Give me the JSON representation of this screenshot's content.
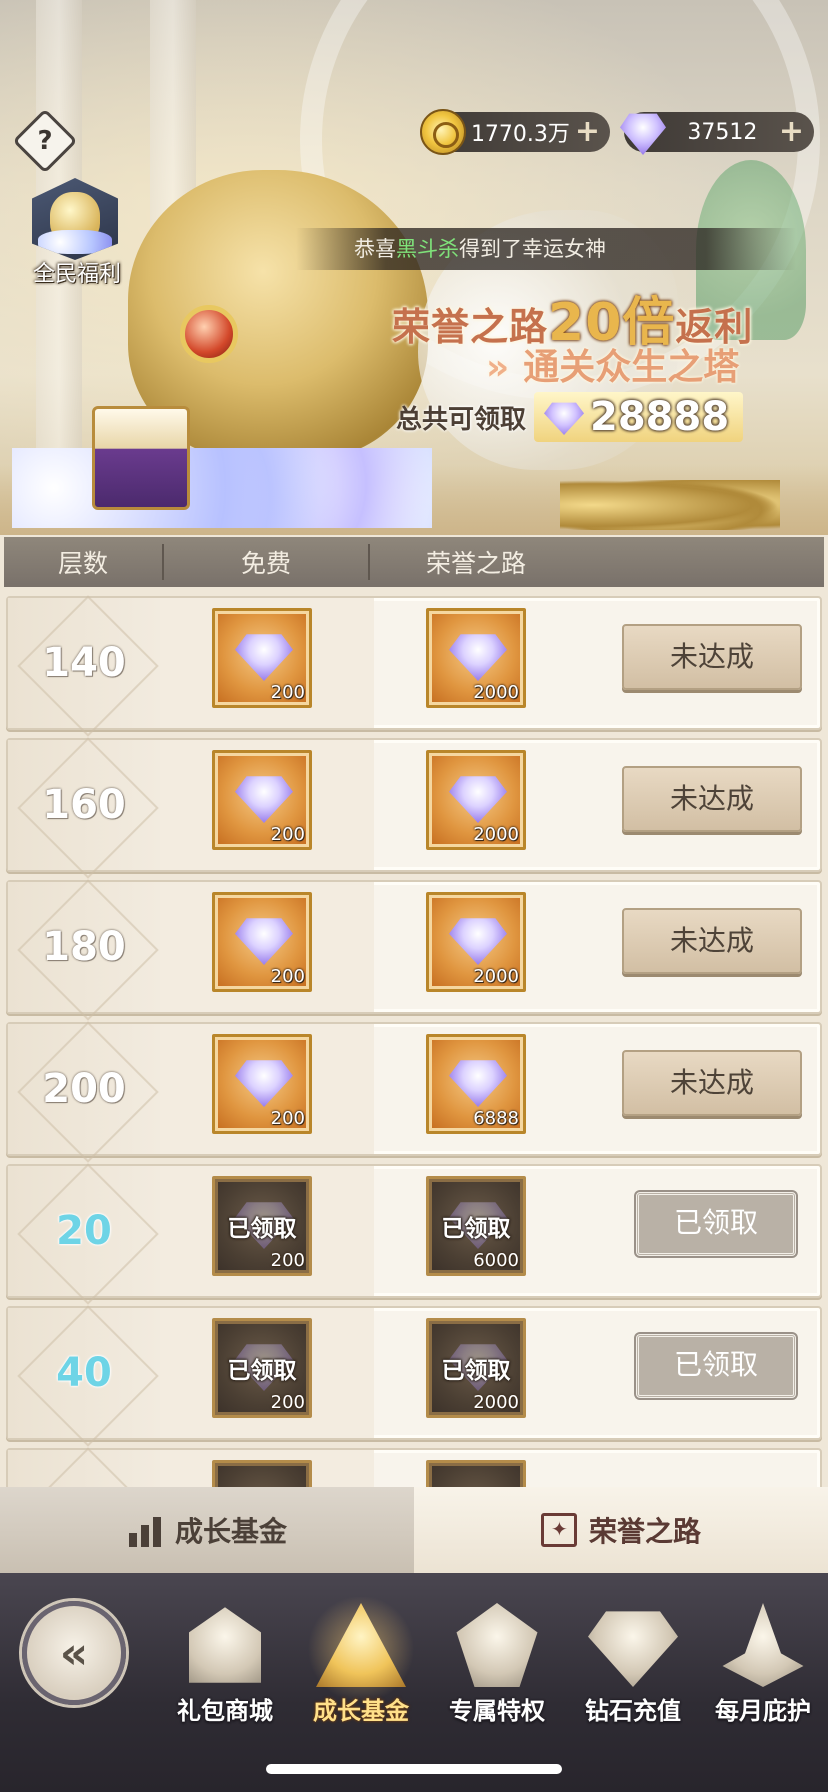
{
  "header": {
    "help_icon_glyph": "?",
    "welfare_label": "全民福利",
    "currencies": {
      "gold": {
        "value": "1770.3万",
        "plus": "+"
      },
      "diamond": {
        "value": "37512",
        "plus": "+"
      }
    },
    "notice": {
      "prefix": "恭喜",
      "player": "黑斗杀",
      "suffix": "得到了幸运女神"
    },
    "promo": {
      "line1_pre": "荣誉之路",
      "line1_big": "20倍",
      "line1_post": "返利",
      "line2_chevron": "»",
      "line2": "通关众生之塔",
      "total_label": "总共可领取",
      "total_amount": "28888"
    }
  },
  "table": {
    "headers": [
      "层数",
      "免费",
      "荣誉之路"
    ],
    "rows": [
      {
        "floor": "140",
        "free_qty": "200",
        "honor_qty": "2000",
        "status": "未达成",
        "claimed": false
      },
      {
        "floor": "160",
        "free_qty": "200",
        "honor_qty": "2000",
        "status": "未达成",
        "claimed": false
      },
      {
        "floor": "180",
        "free_qty": "200",
        "honor_qty": "2000",
        "status": "未达成",
        "claimed": false
      },
      {
        "floor": "200",
        "free_qty": "200",
        "honor_qty": "6888",
        "status": "未达成",
        "claimed": false
      },
      {
        "floor": "20",
        "free_qty": "200",
        "honor_qty": "6000",
        "status": "已领取",
        "claimed": true,
        "stamp": "已领取"
      },
      {
        "floor": "40",
        "free_qty": "200",
        "honor_qty": "2000",
        "status": "已领取",
        "claimed": true,
        "stamp": "已领取"
      }
    ]
  },
  "tabs": [
    {
      "label": "成长基金",
      "icon": "bar-chart-icon",
      "active": false
    },
    {
      "label": "荣誉之路",
      "icon": "honor-scroll-icon",
      "active": true
    }
  ],
  "bottom_nav": {
    "back_glyph": "«",
    "items": [
      {
        "label": "礼包商城",
        "icon": "gift-shop-icon",
        "active": false
      },
      {
        "label": "成长基金",
        "icon": "growth-fund-icon",
        "active": true
      },
      {
        "label": "专属特权",
        "icon": "privilege-icon",
        "active": false
      },
      {
        "label": "钻石充值",
        "icon": "diamond-recharge-icon",
        "active": false
      },
      {
        "label": "每月庇护",
        "icon": "monthly-protection-icon",
        "active": false
      }
    ]
  }
}
